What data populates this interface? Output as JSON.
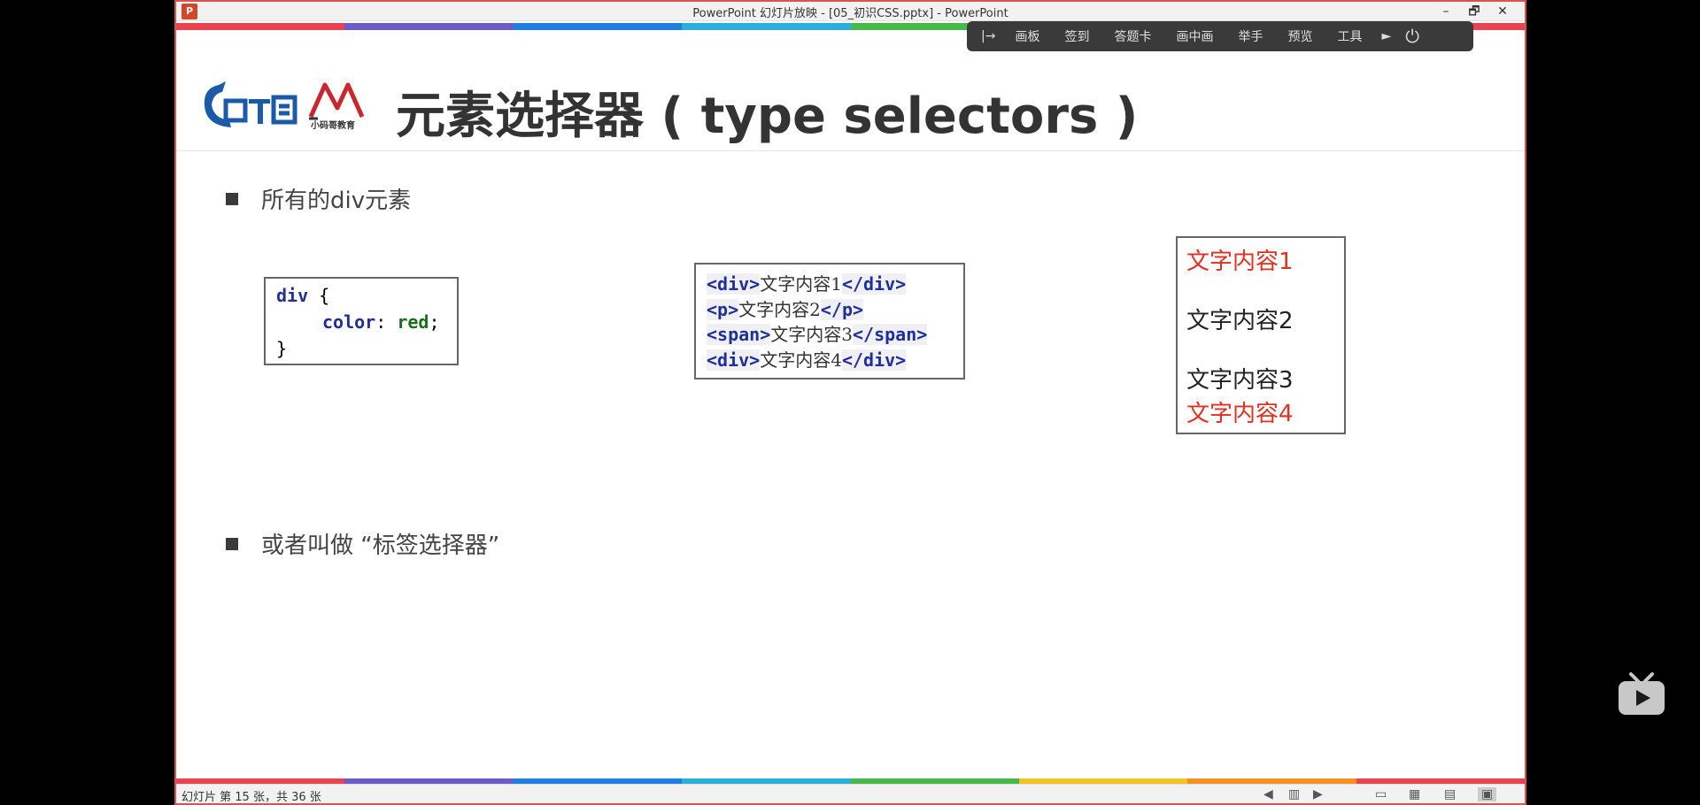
{
  "window": {
    "title": "PowerPoint 幻灯片放映 - [05_初识CSS.pptx] - PowerPoint",
    "app_logo": "P",
    "controls": {
      "minimize": "–",
      "restore": "🗗",
      "close": "✕"
    }
  },
  "stripe_colors": [
    "#e8434f",
    "#6b5bc8",
    "#1f7fe0",
    "#2ab0d8",
    "#45b94a",
    "#f5c320",
    "#f39020",
    "#e8434f"
  ],
  "slide_toolbar": {
    "items": [
      "画板",
      "签到",
      "答题卡",
      "画中画",
      "举手",
      "预览",
      "工具"
    ],
    "pin_icon": "|→",
    "arrow_icon": "►",
    "power_icon": "⏻"
  },
  "slide": {
    "title": "元素选择器 ( type selectors )",
    "logo2_text": "小码哥教育",
    "bullets": [
      "所有的div元素",
      "或者叫做 “标签选择器”"
    ],
    "css_code": {
      "selector": "div",
      "open_brace": "{",
      "property": "color",
      "colon": ":",
      "value": "red",
      "semicolon": ";",
      "close_brace": "}"
    },
    "html_code": [
      {
        "open": "<div>",
        "text": "文字内容1",
        "close": "</div>"
      },
      {
        "open": "<p>",
        "text": "文字内容2",
        "close": "</p>"
      },
      {
        "open": "<span>",
        "text": "文字内容3",
        "close": "</span>"
      },
      {
        "open": "<div>",
        "text": "文字内容4",
        "close": "</div>"
      }
    ],
    "result": [
      {
        "text": "文字内容1",
        "color": "#e03020"
      },
      {
        "text": "文字内容2",
        "color": "#222222"
      },
      {
        "text": "文字内容3",
        "color": "#222222"
      },
      {
        "text": "文字内容4",
        "color": "#e03020"
      }
    ]
  },
  "statusbar": {
    "text": "幻灯片 第 15 张，共 36 张",
    "icons": [
      "prev-icon",
      "notes-icon",
      "next-icon",
      "normal-view-icon",
      "sorter-view-icon",
      "reading-view-icon",
      "slideshow-icon"
    ]
  },
  "player_icon": "bilibili-tv-icon"
}
